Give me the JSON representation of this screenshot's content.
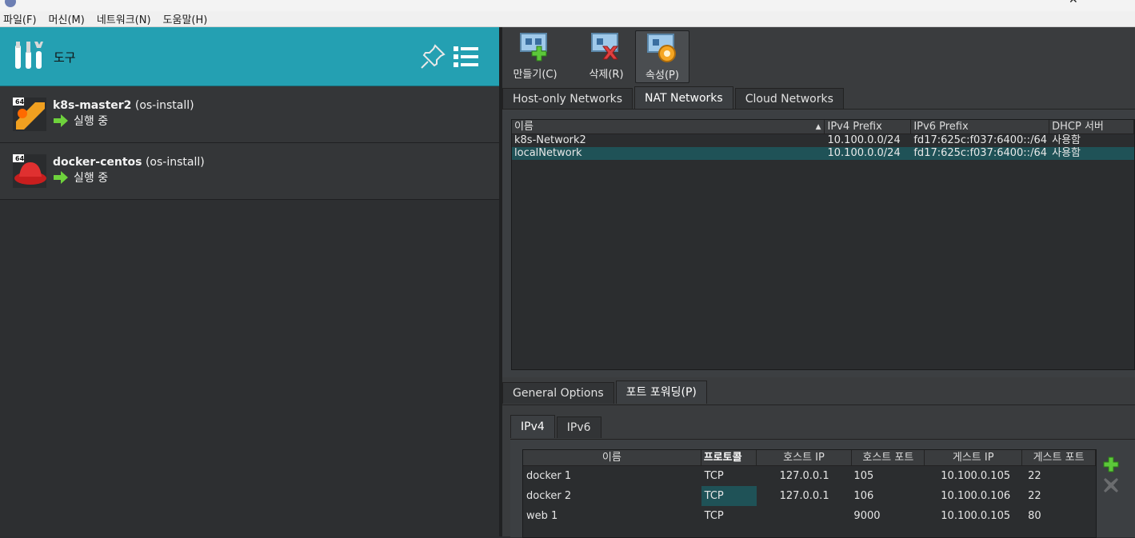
{
  "menu": [
    "파일(F)",
    "머신(M)",
    "네트워크(N)",
    "도움말(H)"
  ],
  "tools": {
    "label": "도구"
  },
  "vms": [
    {
      "name": "k8s-master2",
      "snapshot": "(os-install)",
      "state": "실행 중",
      "badge": "64"
    },
    {
      "name": "docker-centos",
      "snapshot": "(os-install)",
      "state": "실행 중",
      "badge": "64"
    }
  ],
  "toolbar": {
    "create": "만들기(C)",
    "remove": "삭제(R)",
    "properties": "속성(P)"
  },
  "network_tabs": [
    "Host-only Networks",
    "NAT Networks",
    "Cloud Networks"
  ],
  "net_table": {
    "headers": [
      "이름",
      "IPv4 Prefix",
      "IPv6 Prefix",
      "DHCP 서버"
    ],
    "rows": [
      [
        "k8s-Network2",
        "10.100.0.0/24",
        "fd17:625c:f037:6400::/64",
        "사용함"
      ],
      [
        "localNetwork",
        "10.100.0.0/24",
        "fd17:625c:f037:6400::/64",
        "사용함"
      ]
    ]
  },
  "option_tabs": [
    "General Options",
    "포트 포워딩(P)"
  ],
  "ip_tabs": [
    "IPv4",
    "IPv6"
  ],
  "pf_table": {
    "headers": [
      "이름",
      "프로토콜",
      "호스트 IP",
      "호스트 포트",
      "게스트 IP",
      "게스트 포트"
    ],
    "rows": [
      [
        "docker 1",
        "TCP",
        "127.0.0.1",
        "105",
        "10.100.0.105",
        "22"
      ],
      [
        "docker 2",
        "TCP",
        "127.0.0.1",
        "106",
        "10.100.0.106",
        "22"
      ],
      [
        "web 1",
        "TCP",
        "",
        "9000",
        "10.100.0.105",
        "80"
      ]
    ]
  },
  "colors": {
    "tools_bar": "#24a0b2",
    "selection": "#1f5257",
    "add_green": "#5cc73a",
    "remove_red": "#e04040"
  }
}
